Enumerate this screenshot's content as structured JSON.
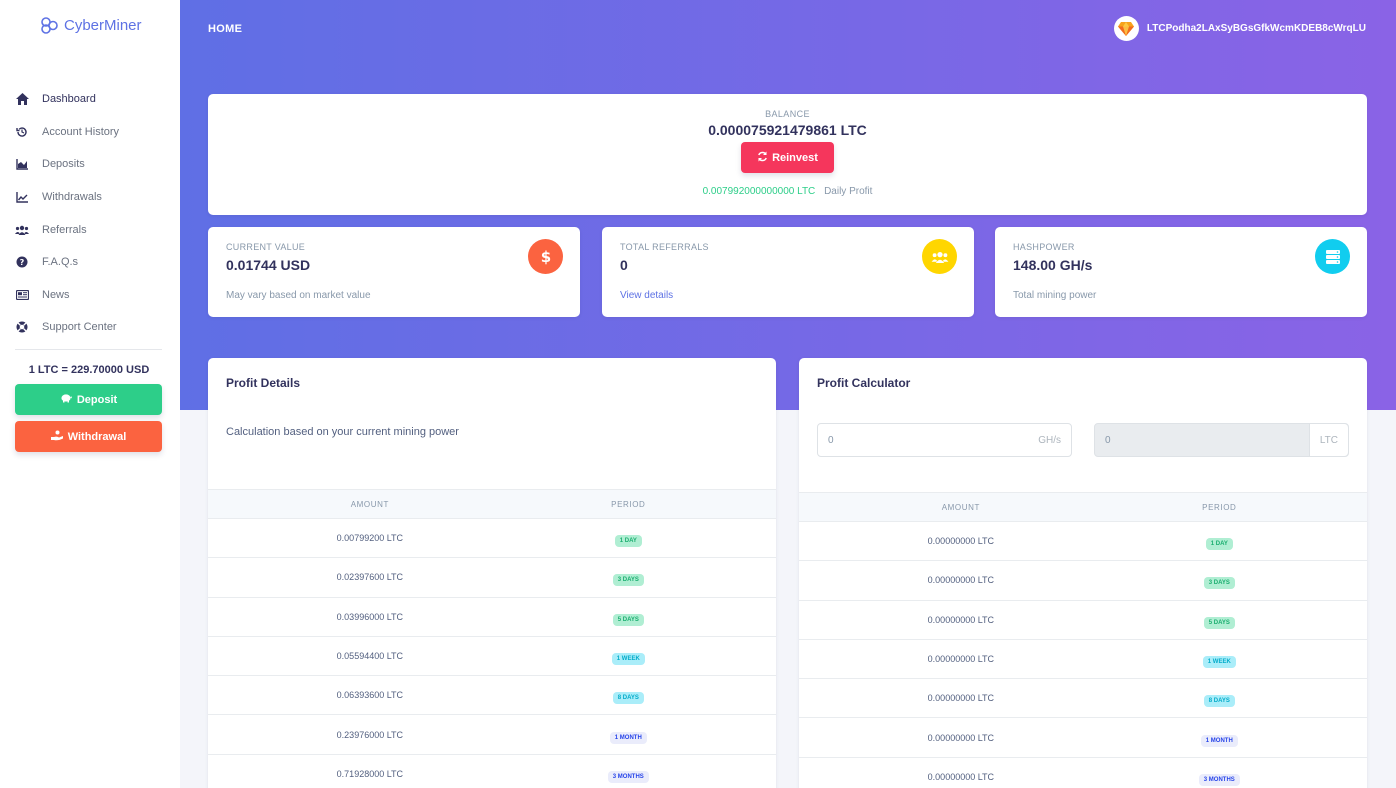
{
  "brand": {
    "name": "CyberMiner"
  },
  "nav": [
    {
      "label": "Dashboard",
      "icon": "home-icon"
    },
    {
      "label": "Account History",
      "icon": "history-icon"
    },
    {
      "label": "Deposits",
      "icon": "area-chart-icon"
    },
    {
      "label": "Withdrawals",
      "icon": "line-chart-icon"
    },
    {
      "label": "Referrals",
      "icon": "users-icon"
    },
    {
      "label": "F.A.Q.s",
      "icon": "question-circle-icon"
    },
    {
      "label": "News",
      "icon": "newspaper-icon"
    },
    {
      "label": "Support Center",
      "icon": "life-ring-icon"
    }
  ],
  "rate": "1 LTC = 229.70000 USD",
  "sidebar_buttons": {
    "deposit": "Deposit",
    "withdrawal": "Withdrawal"
  },
  "header": {
    "home": "HOME",
    "user": "LTCPodha2LAxSyBGsGfkWcmKDEB8cWrqLU"
  },
  "balance": {
    "label": "BALANCE",
    "value": "0.000075921479861 LTC",
    "reinvest": "Reinvest",
    "daily_value": "0.007992000000000 LTC",
    "daily_label": "Daily Profit"
  },
  "stats": [
    {
      "title": "CURRENT VALUE",
      "value": "0.01744 USD",
      "sub": "May vary based on market value",
      "icon": "dollar-icon",
      "color": "#fb6340"
    },
    {
      "title": "TOTAL REFERRALS",
      "value": "0",
      "sub": "View details",
      "icon": "users-icon",
      "color": "#ffd600"
    },
    {
      "title": "HASHPOWER",
      "value": "148.00 GH/s",
      "sub": "Total mining power",
      "icon": "server-icon",
      "color": "#11cdef"
    }
  ],
  "profit_details": {
    "title": "Profit Details",
    "description": "Calculation based on your current mining power",
    "columns": [
      "AMOUNT",
      "PERIOD"
    ],
    "rows": [
      {
        "amount": "0.00799200 LTC",
        "period": "1 DAY"
      },
      {
        "amount": "0.02397600 LTC",
        "period": "3 DAYS"
      },
      {
        "amount": "0.03996000 LTC",
        "period": "5 DAYS"
      },
      {
        "amount": "0.05594400 LTC",
        "period": "1 WEEK"
      },
      {
        "amount": "0.06393600 LTC",
        "period": "8 DAYS"
      },
      {
        "amount": "0.23976000 LTC",
        "period": "1 MONTH"
      },
      {
        "amount": "0.71928000 LTC",
        "period": "3 MONTHS"
      }
    ]
  },
  "profit_calculator": {
    "title": "Profit Calculator",
    "hash_input": {
      "value": "0",
      "unit": "GH/s"
    },
    "ltc_input": {
      "value": "0",
      "unit": "LTC"
    },
    "columns": [
      "AMOUNT",
      "PERIOD"
    ],
    "rows": [
      {
        "amount": "0.00000000 LTC",
        "period": "1 DAY"
      },
      {
        "amount": "0.00000000 LTC",
        "period": "3 DAYS"
      },
      {
        "amount": "0.00000000 LTC",
        "period": "5 DAYS"
      },
      {
        "amount": "0.00000000 LTC",
        "period": "1 WEEK"
      },
      {
        "amount": "0.00000000 LTC",
        "period": "8 DAYS"
      },
      {
        "amount": "0.00000000 LTC",
        "period": "1 MONTH"
      },
      {
        "amount": "0.00000000 LTC",
        "period": "3 MONTHS"
      }
    ]
  },
  "badge_colors": {
    "1 DAY": "green",
    "3 DAYS": "green",
    "5 DAYS": "green",
    "1 WEEK": "cyan",
    "8 DAYS": "cyan",
    "1 MONTH": "blue",
    "3 MONTHS": "blue"
  }
}
